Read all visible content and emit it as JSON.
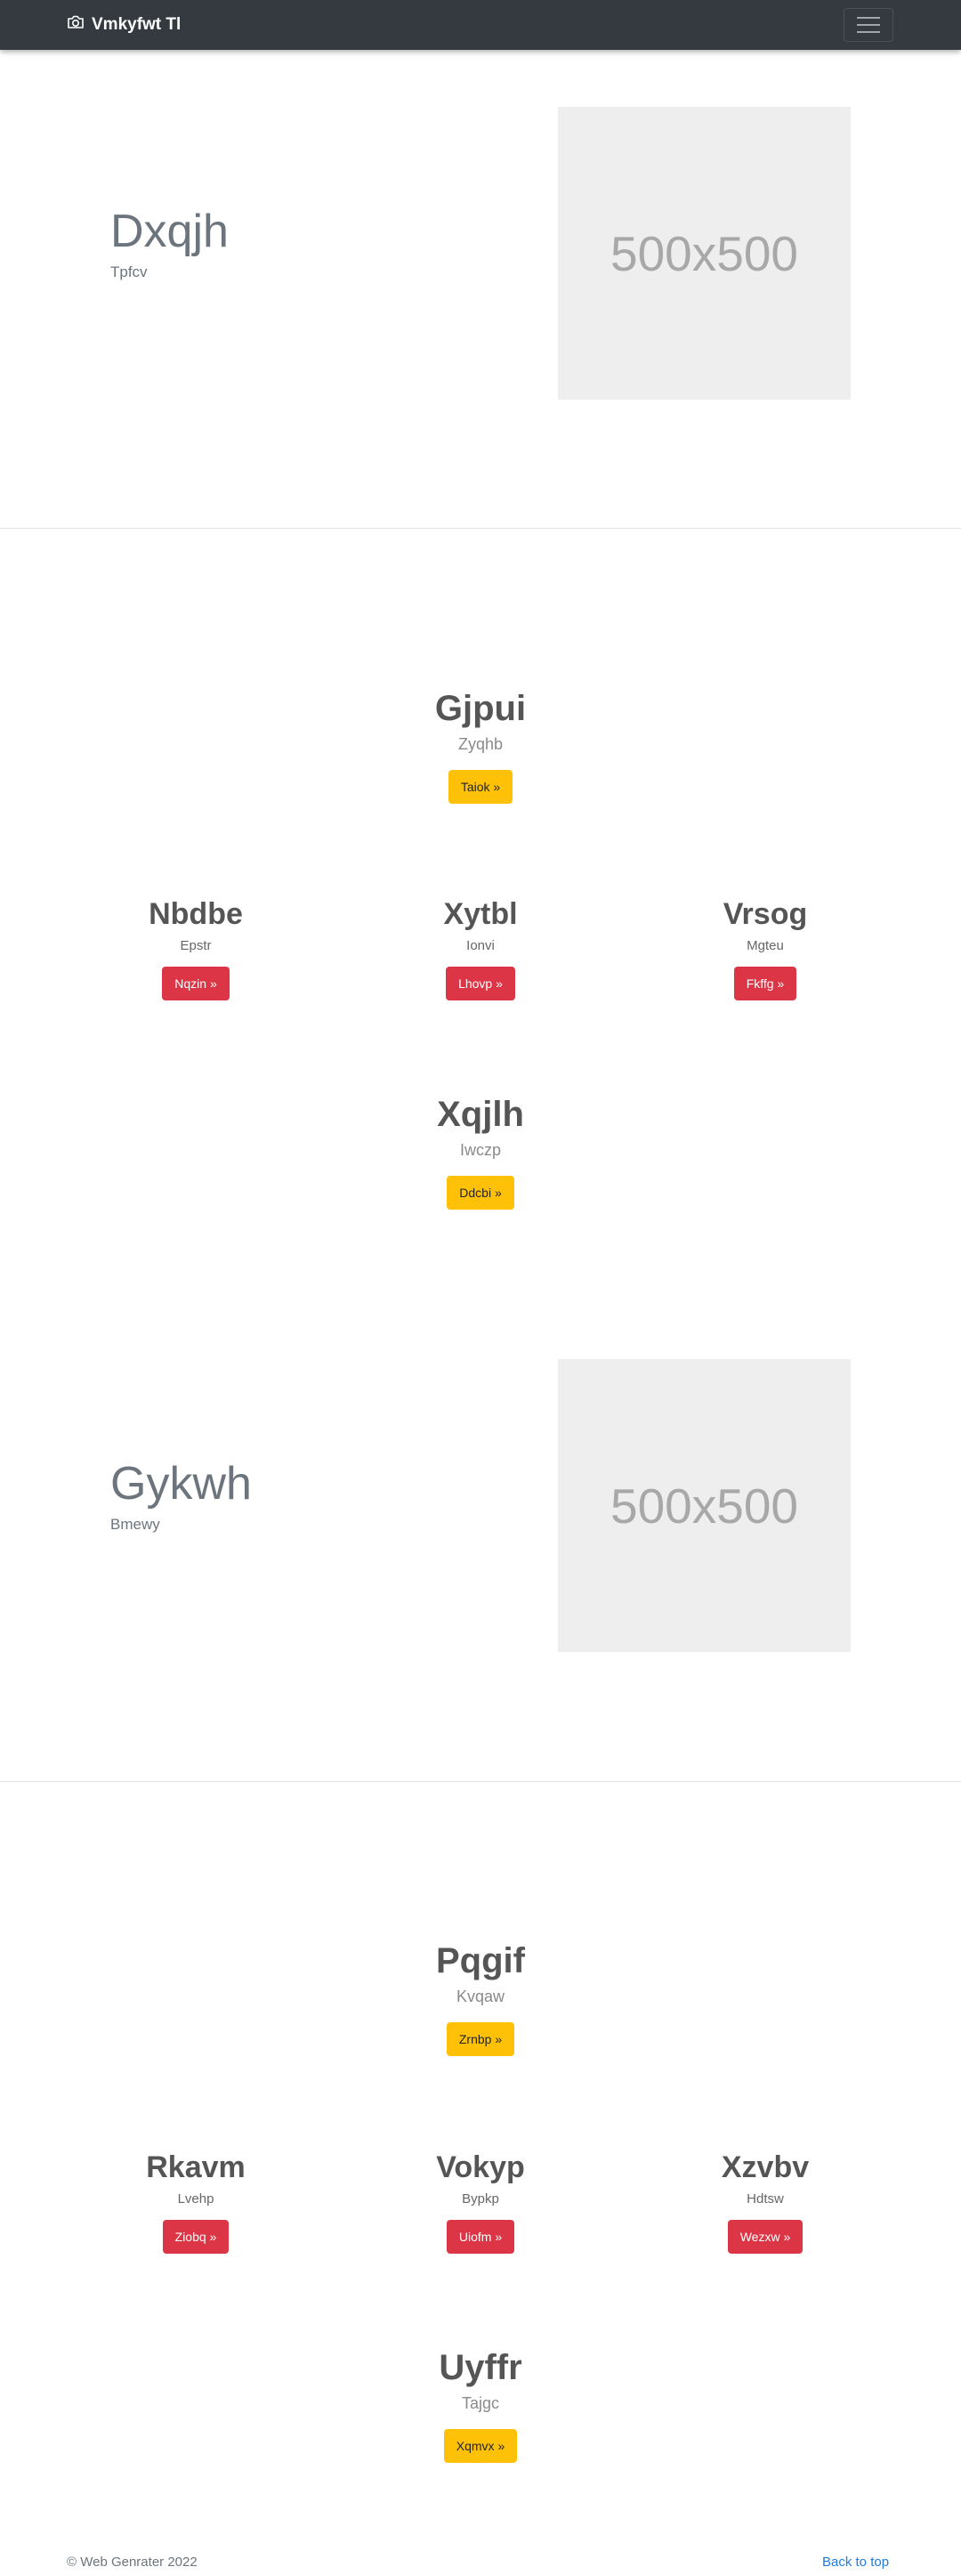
{
  "navbar": {
    "brand": "Vmkyfwt Tl",
    "brand_icon": "camera-icon",
    "toggler_icon": "hamburger-icon"
  },
  "hero1": {
    "title": "Dxqjh",
    "subtitle": "Tpfcv",
    "image_label": "500x500"
  },
  "section1": {
    "feature": {
      "title": "Gjpui",
      "subtitle": "Zyqhb",
      "button": "Taiok »"
    },
    "columns": [
      {
        "title": "Nbdbe",
        "subtitle": "Epstr",
        "button": "Nqzin »"
      },
      {
        "title": "Xytbl",
        "subtitle": "Ionvi",
        "button": "Lhovp »"
      },
      {
        "title": "Vrsog",
        "subtitle": "Mgteu",
        "button": "Fkffg »"
      }
    ],
    "feature2": {
      "title": "Xqjlh",
      "subtitle": "Iwczp",
      "button": "Ddcbi »"
    }
  },
  "hero2": {
    "title": "Gykwh",
    "subtitle": "Bmewy",
    "image_label": "500x500"
  },
  "section2": {
    "feature": {
      "title": "Pqgif",
      "subtitle": "Kvqaw",
      "button": "Zrnbp »"
    },
    "columns": [
      {
        "title": "Rkavm",
        "subtitle": "Lvehp",
        "button": "Ziobq »"
      },
      {
        "title": "Vokyp",
        "subtitle": "Bypkp",
        "button": "Uiofm »"
      },
      {
        "title": "Xzvbv",
        "subtitle": "Hdtsw",
        "button": "Wezxw »"
      }
    ],
    "feature2": {
      "title": "Uyffr",
      "subtitle": "Tajgc",
      "button": "Xqmvx »"
    }
  },
  "footer": {
    "copyright": "© Web Genrater 2022",
    "back_to_top": "Back to top"
  },
  "colors": {
    "navbar": "#343a40",
    "warning": "#ffc107",
    "danger": "#dc3545",
    "link": "#1e7be0"
  }
}
